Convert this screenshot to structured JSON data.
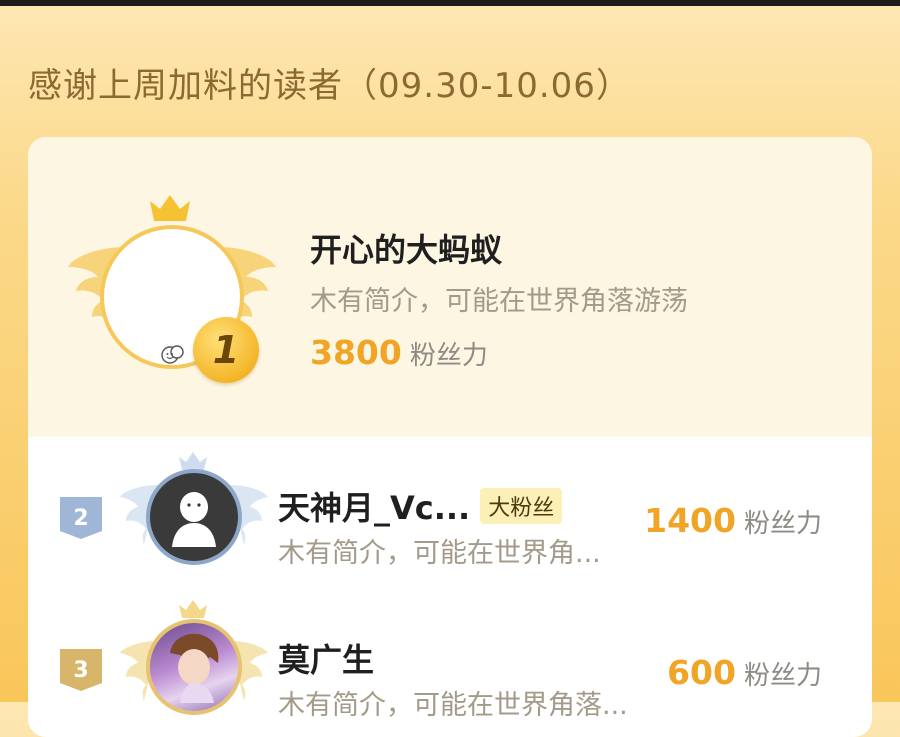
{
  "header": {
    "title": "感谢上周加料的读者（09.30-10.06）"
  },
  "first": {
    "rank": "1",
    "name": "开心的大蚂蚁",
    "bio": "木有简介，可能在世界角落游荡",
    "score": "3800",
    "unit": "粉丝力"
  },
  "rows": [
    {
      "rank": "2",
      "name": "天神月_Vc...",
      "tag": "大粉丝",
      "bio": "木有简介，可能在世界角...",
      "score": "1400",
      "unit": "粉丝力"
    },
    {
      "rank": "3",
      "name": "莫广生",
      "bio": "木有简介，可能在世界角落...",
      "score": "600",
      "unit": "粉丝力"
    }
  ],
  "colors": {
    "accent": "#f0a526",
    "rank2": "#9fb6d6",
    "rank3": "#d7b56a",
    "title": "#8a6a2f"
  },
  "icons": [
    "crown-icon",
    "wing-icon",
    "smile-face-icon",
    "rank-medal-icon",
    "default-avatar-icon"
  ]
}
